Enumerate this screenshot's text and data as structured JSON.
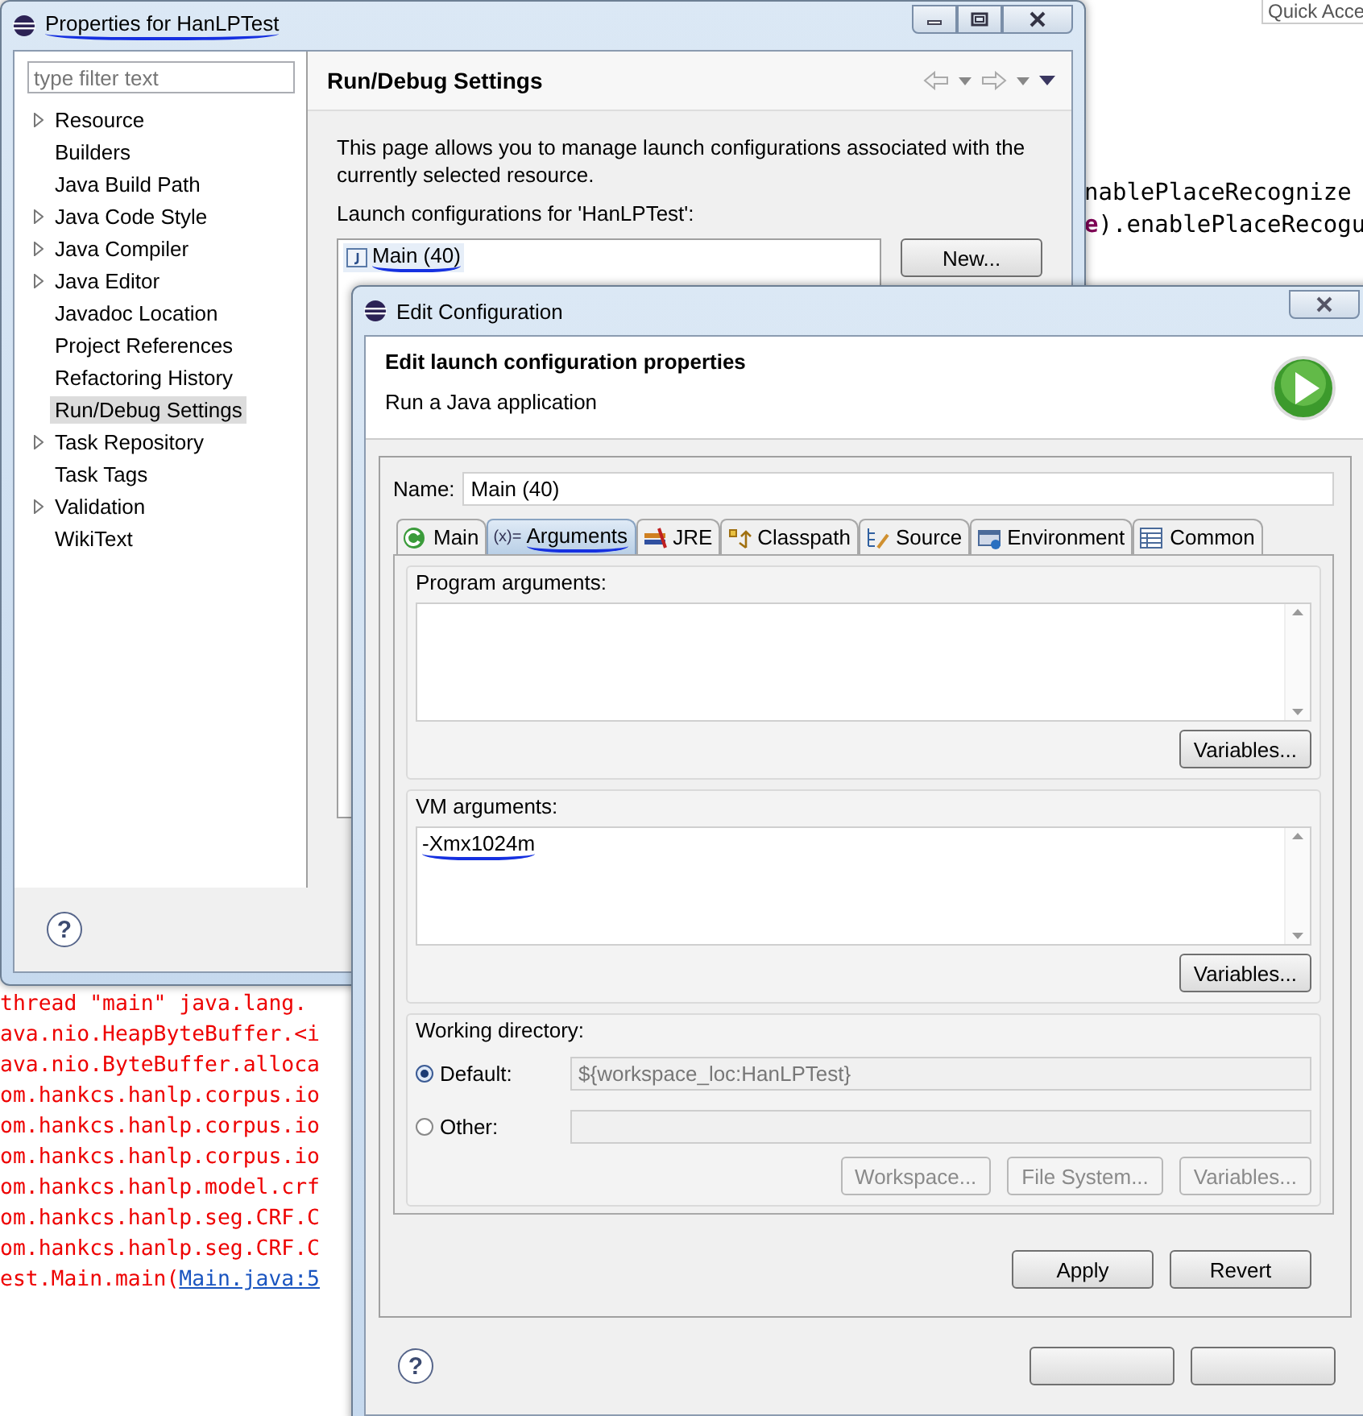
{
  "editor": {
    "quick_access": "Quick Acce",
    "lines": [
      {
        "text": "nablePlaceRecognize"
      },
      {
        "keyword": "e",
        "text": ").enablePlaceRecogu"
      }
    ]
  },
  "console": {
    "lines": [
      {
        "text": "thread \"main\" java.lang."
      },
      {
        "text": "ava.nio.HeapByteBuffer.<i"
      },
      {
        "text": "ava.nio.ByteBuffer.alloca"
      },
      {
        "text": "om.hankcs.hanlp.corpus.io"
      },
      {
        "text": "om.hankcs.hanlp.corpus.io"
      },
      {
        "text": "om.hankcs.hanlp.corpus.io"
      },
      {
        "text": "om.hankcs.hanlp.model.crf"
      },
      {
        "text": "om.hankcs.hanlp.seg.CRF.C"
      },
      {
        "text": "om.hankcs.hanlp.seg.CRF.C"
      },
      {
        "text": "est.Main.main(",
        "link": "Main.java:5"
      }
    ]
  },
  "properties_window": {
    "title": "Properties for HanLPTest",
    "title_underlined": true,
    "filter": {
      "placeholder": "type filter text"
    },
    "tree": [
      {
        "label": "Resource",
        "expandable": true,
        "selected": false
      },
      {
        "label": "Builders",
        "expandable": false,
        "selected": false
      },
      {
        "label": "Java Build Path",
        "expandable": false,
        "selected": false
      },
      {
        "label": "Java Code Style",
        "expandable": true,
        "selected": false
      },
      {
        "label": "Java Compiler",
        "expandable": true,
        "selected": false
      },
      {
        "label": "Java Editor",
        "expandable": true,
        "selected": false
      },
      {
        "label": "Javadoc Location",
        "expandable": false,
        "selected": false
      },
      {
        "label": "Project References",
        "expandable": false,
        "selected": false
      },
      {
        "label": "Refactoring History",
        "expandable": false,
        "selected": false
      },
      {
        "label": "Run/Debug Settings",
        "expandable": false,
        "selected": true
      },
      {
        "label": "Task Repository",
        "expandable": true,
        "selected": false
      },
      {
        "label": "Task Tags",
        "expandable": false,
        "selected": false
      },
      {
        "label": "Validation",
        "expandable": true,
        "selected": false
      },
      {
        "label": "WikiText",
        "expandable": false,
        "selected": false
      }
    ],
    "help": "?",
    "page": {
      "heading": "Run/Debug Settings",
      "description": "This page allows you to manage launch configurations associated with the currently selected resource.",
      "list_label": "Launch configurations for 'HanLPTest':",
      "configurations": [
        {
          "label": "Main (40)",
          "underlined": true
        }
      ],
      "buttons": [
        {
          "label": "New...",
          "disabled": false
        }
      ]
    }
  },
  "edit_dialog": {
    "title": "Edit Configuration",
    "heading": "Edit launch configuration properties",
    "subheading": "Run a Java application",
    "name_label": "Name:",
    "name_value": "Main (40)",
    "tabs": [
      {
        "label": "Main",
        "selected": false,
        "underlined": false
      },
      {
        "label": "Arguments",
        "symbol": "(x)=",
        "selected": true,
        "underlined": true
      },
      {
        "label": "JRE",
        "selected": false,
        "underlined": false
      },
      {
        "label": "Classpath",
        "selected": false,
        "underlined": false
      },
      {
        "label": "Source",
        "selected": false,
        "underlined": false
      },
      {
        "label": "Environment",
        "selected": false,
        "underlined": false
      },
      {
        "label": "Common",
        "selected": false,
        "underlined": false
      }
    ],
    "program_arguments": {
      "label": "Program arguments:",
      "button": {
        "label": "Variables...",
        "disabled": false
      }
    },
    "vm_arguments": {
      "label": "VM arguments:",
      "value": "-Xmx1024m",
      "underlined": true,
      "button": {
        "label": "Variables...",
        "disabled": false
      }
    },
    "working_directory": {
      "label": "Working directory:",
      "options": [
        {
          "label": "Default:",
          "selected": true,
          "value": "${workspace_loc:HanLPTest}"
        },
        {
          "label": "Other:",
          "selected": false
        }
      ],
      "buttons": [
        {
          "label": "Workspace...",
          "disabled": true
        },
        {
          "label": "File System...",
          "disabled": true
        },
        {
          "label": "Variables...",
          "disabled": true
        }
      ]
    },
    "buttons": [
      {
        "label": "Apply",
        "disabled": false
      },
      {
        "label": "Revert",
        "disabled": false
      }
    ],
    "help": "?"
  }
}
